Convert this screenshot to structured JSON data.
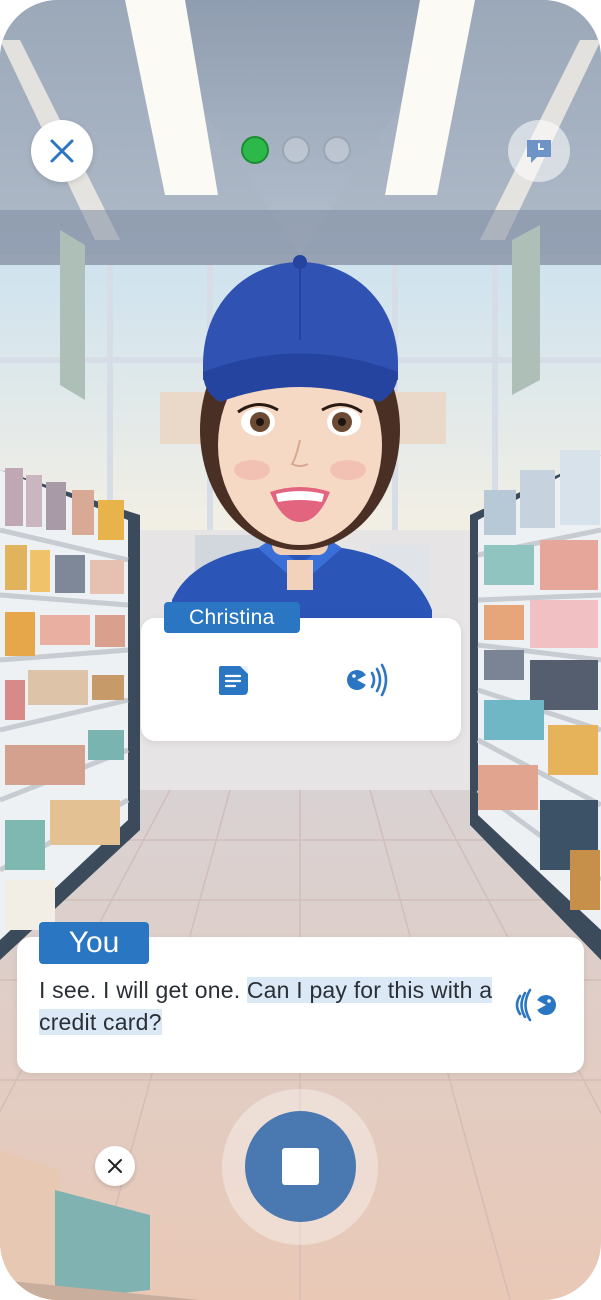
{
  "header": {
    "close_icon": "close-icon",
    "history_icon": "chat-history-icon",
    "progress": {
      "total_steps": 3,
      "current_step": 1,
      "active_color": "#2db84a"
    }
  },
  "npc": {
    "name": "Christina",
    "text_icon": "text-message-icon",
    "audio_icon": "speaker-audio-icon"
  },
  "user": {
    "label": "You",
    "message_plain": "I see. I will get one. ",
    "message_highlight": "Can I pay for this with a credit card?",
    "audio_icon": "speaker-audio-icon"
  },
  "controls": {
    "dismiss_icon": "close-icon",
    "stop_icon": "stop-icon"
  },
  "colors": {
    "accent": "#2b76c2",
    "stop_button": "#4a78b0",
    "highlight": "#dbe8f6"
  }
}
